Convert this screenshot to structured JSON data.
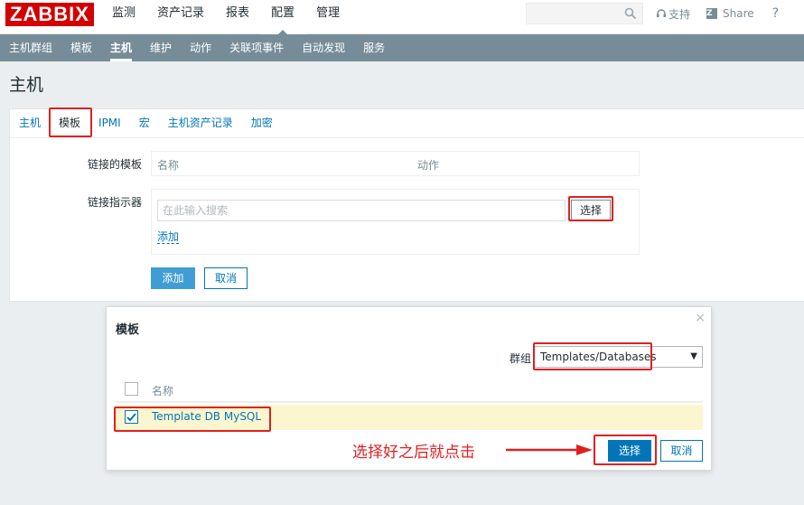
{
  "app": {
    "logo": "ZABBIX"
  },
  "topnav": {
    "items": [
      "监测",
      "资产记录",
      "报表",
      "配置",
      "管理"
    ],
    "active_index": 3
  },
  "search": {
    "placeholder": ""
  },
  "toplinks": {
    "support": "支持",
    "share": "Share",
    "help": "?"
  },
  "subnav": {
    "items": [
      "主机群组",
      "模板",
      "主机",
      "维护",
      "动作",
      "关联项事件",
      "自动发现",
      "服务"
    ],
    "active_index": 2
  },
  "page": {
    "title": "主机"
  },
  "tabs": {
    "items": [
      "主机",
      "模板",
      "IPMI",
      "宏",
      "主机资产记录",
      "加密"
    ],
    "active_index": 1
  },
  "form": {
    "linked_templates_label": "链接的模板",
    "col_name": "名称",
    "col_action": "动作",
    "link_indicator_label": "链接指示器",
    "search_placeholder": "在此输入搜索",
    "select_button": "选择",
    "add_link": "添加",
    "add_button": "添加",
    "cancel_button": "取消"
  },
  "dialog": {
    "title": "模板",
    "close": "×",
    "group_label": "群组",
    "group_value": "Templates/Databases",
    "col_name": "名称",
    "rows": [
      {
        "name": "Template DB MySQL",
        "checked": true
      }
    ],
    "select_button": "选择",
    "cancel_button": "取消"
  },
  "annotation": {
    "text": "选择好之后就点击"
  },
  "colors": {
    "accent": "#0275b8",
    "nav": "#768d99",
    "highlight": "#e02020",
    "logo": "#d40000"
  }
}
